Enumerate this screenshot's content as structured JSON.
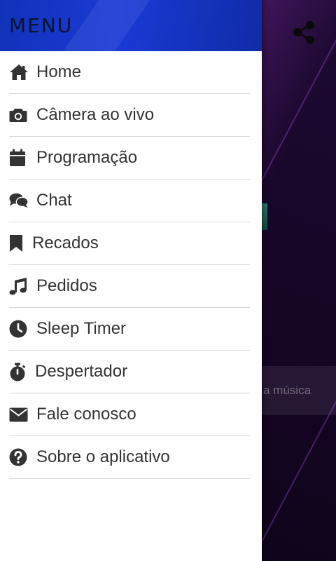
{
  "drawer": {
    "title": "MENU",
    "items": [
      {
        "label": "Home",
        "icon": "home-icon"
      },
      {
        "label": "Câmera ao vivo",
        "icon": "camera-icon"
      },
      {
        "label": "Programação",
        "icon": "calendar-icon"
      },
      {
        "label": "Chat",
        "icon": "chat-icon"
      },
      {
        "label": "Recados",
        "icon": "bookmark-icon"
      },
      {
        "label": "Pedidos",
        "icon": "music-note-icon"
      },
      {
        "label": "Sleep Timer",
        "icon": "clock-icon"
      },
      {
        "label": "Despertador",
        "icon": "stopwatch-icon"
      },
      {
        "label": "Fale conosco",
        "icon": "envelope-icon"
      },
      {
        "label": "Sobre o aplicativo",
        "icon": "help-circle-icon"
      }
    ]
  },
  "background": {
    "strip_text": "a música",
    "share_icon": "share-icon"
  },
  "colors": {
    "header": "#1a3ad6",
    "icon": "#333333",
    "divider": "#d8d8d8"
  }
}
